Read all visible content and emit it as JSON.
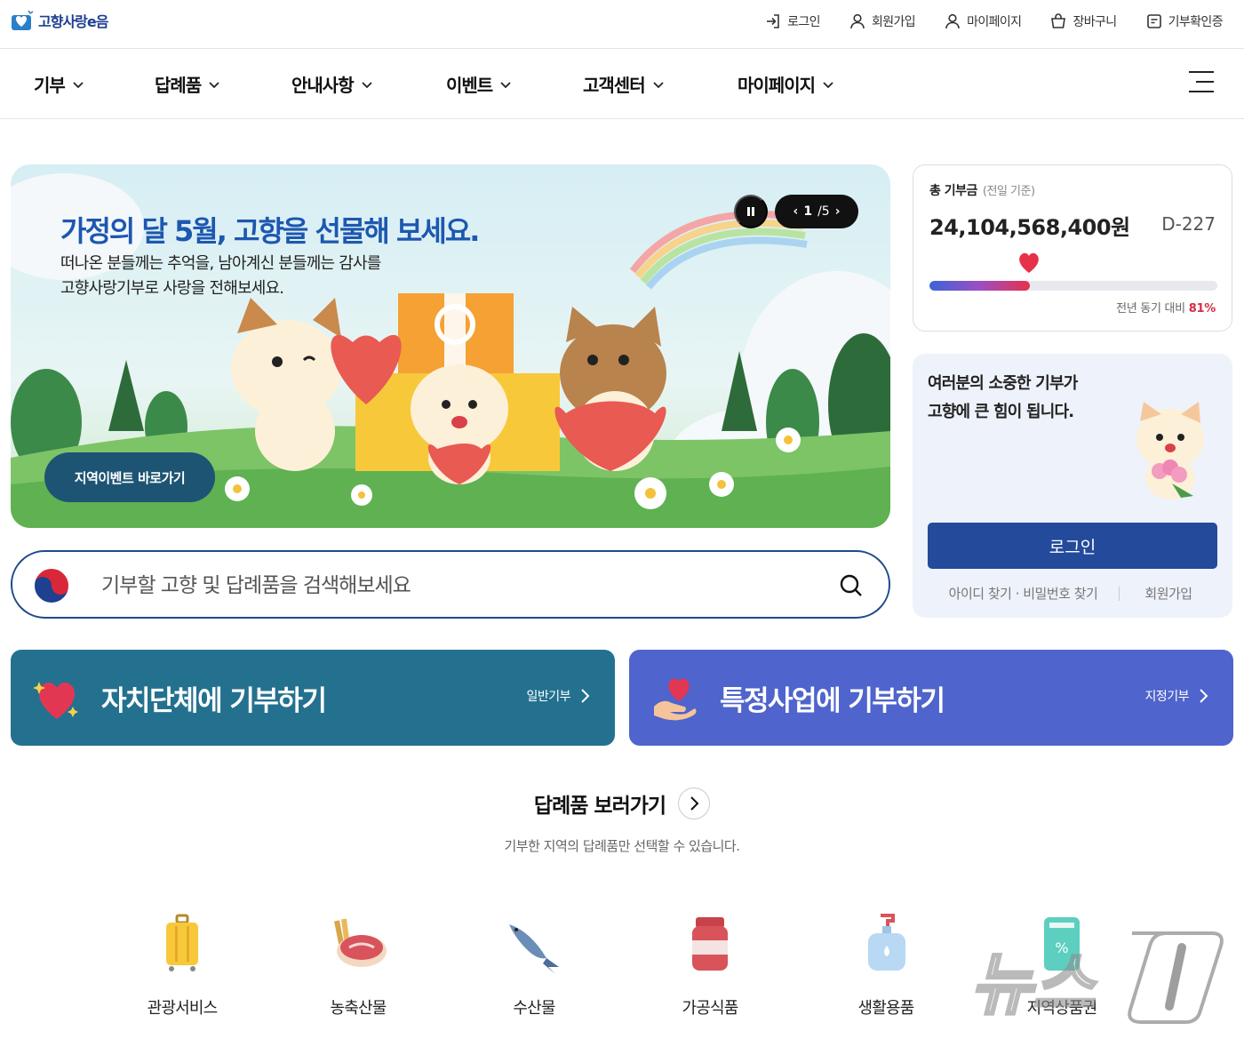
{
  "brand": {
    "logo_text": "고향사랑e음"
  },
  "utility_nav": [
    {
      "label": "로그인",
      "icon": "login-icon"
    },
    {
      "label": "회원가입",
      "icon": "user-icon"
    },
    {
      "label": "마이페이지",
      "icon": "user-icon"
    },
    {
      "label": "장바구니",
      "icon": "cart-icon"
    },
    {
      "label": "기부확인증",
      "icon": "certificate-icon"
    }
  ],
  "main_nav": [
    {
      "label": "기부"
    },
    {
      "label": "답례품"
    },
    {
      "label": "안내사항"
    },
    {
      "label": "이벤트"
    },
    {
      "label": "고객센터"
    },
    {
      "label": "마이페이지"
    }
  ],
  "hero": {
    "title": "가정의 달 5월, 고향을 선물해 보세요.",
    "subtitle": "떠나온 분들께는 추억을, 남아계신 분들께는 감사를\n고향사랑기부로 사랑을 전해보세요.",
    "cta": "지역이벤트 바로가기",
    "pager_current": "1",
    "pager_total": "/5"
  },
  "search": {
    "placeholder": "기부할 고향 및 답례품을 검색해보세요"
  },
  "total": {
    "label": "총 기부금",
    "label_sub": "(전일 기준)",
    "amount": "24,104,568,400원",
    "dday": "D-227",
    "progress_fraction": 0.35,
    "compare_label": "전년 동기 대비",
    "compare_pct": "81%"
  },
  "login": {
    "message": "여러분의 소중한 기부가\n고향에 큰 힘이 됩니다.",
    "button": "로그인",
    "find_link": "아이디 찾기 · 비밀번호 찾기",
    "join_link": "회원가입"
  },
  "donate": {
    "local": {
      "title": "자치단체에 기부하기",
      "tag": "일반기부"
    },
    "project": {
      "title": "특정사업에 기부하기",
      "tag": "지정기부"
    }
  },
  "gifts": {
    "title": "답례품 보러가기",
    "description": "기부한 지역의 답례품만 선택할 수 있습니다.",
    "categories": [
      {
        "label": "관광서비스",
        "icon": "suitcase-icon"
      },
      {
        "label": "농축산물",
        "icon": "meat-grain-icon"
      },
      {
        "label": "수산물",
        "icon": "fish-icon"
      },
      {
        "label": "가공식품",
        "icon": "jar-icon"
      },
      {
        "label": "생활용품",
        "icon": "pump-bottle-icon"
      },
      {
        "label": "지역상품권",
        "icon": "voucher-icon"
      }
    ]
  },
  "colors": {
    "brand_navy": "#234a9b",
    "local_donate": "#23718f",
    "project_donate": "#4f64cc",
    "accent_red": "#d62d45"
  }
}
